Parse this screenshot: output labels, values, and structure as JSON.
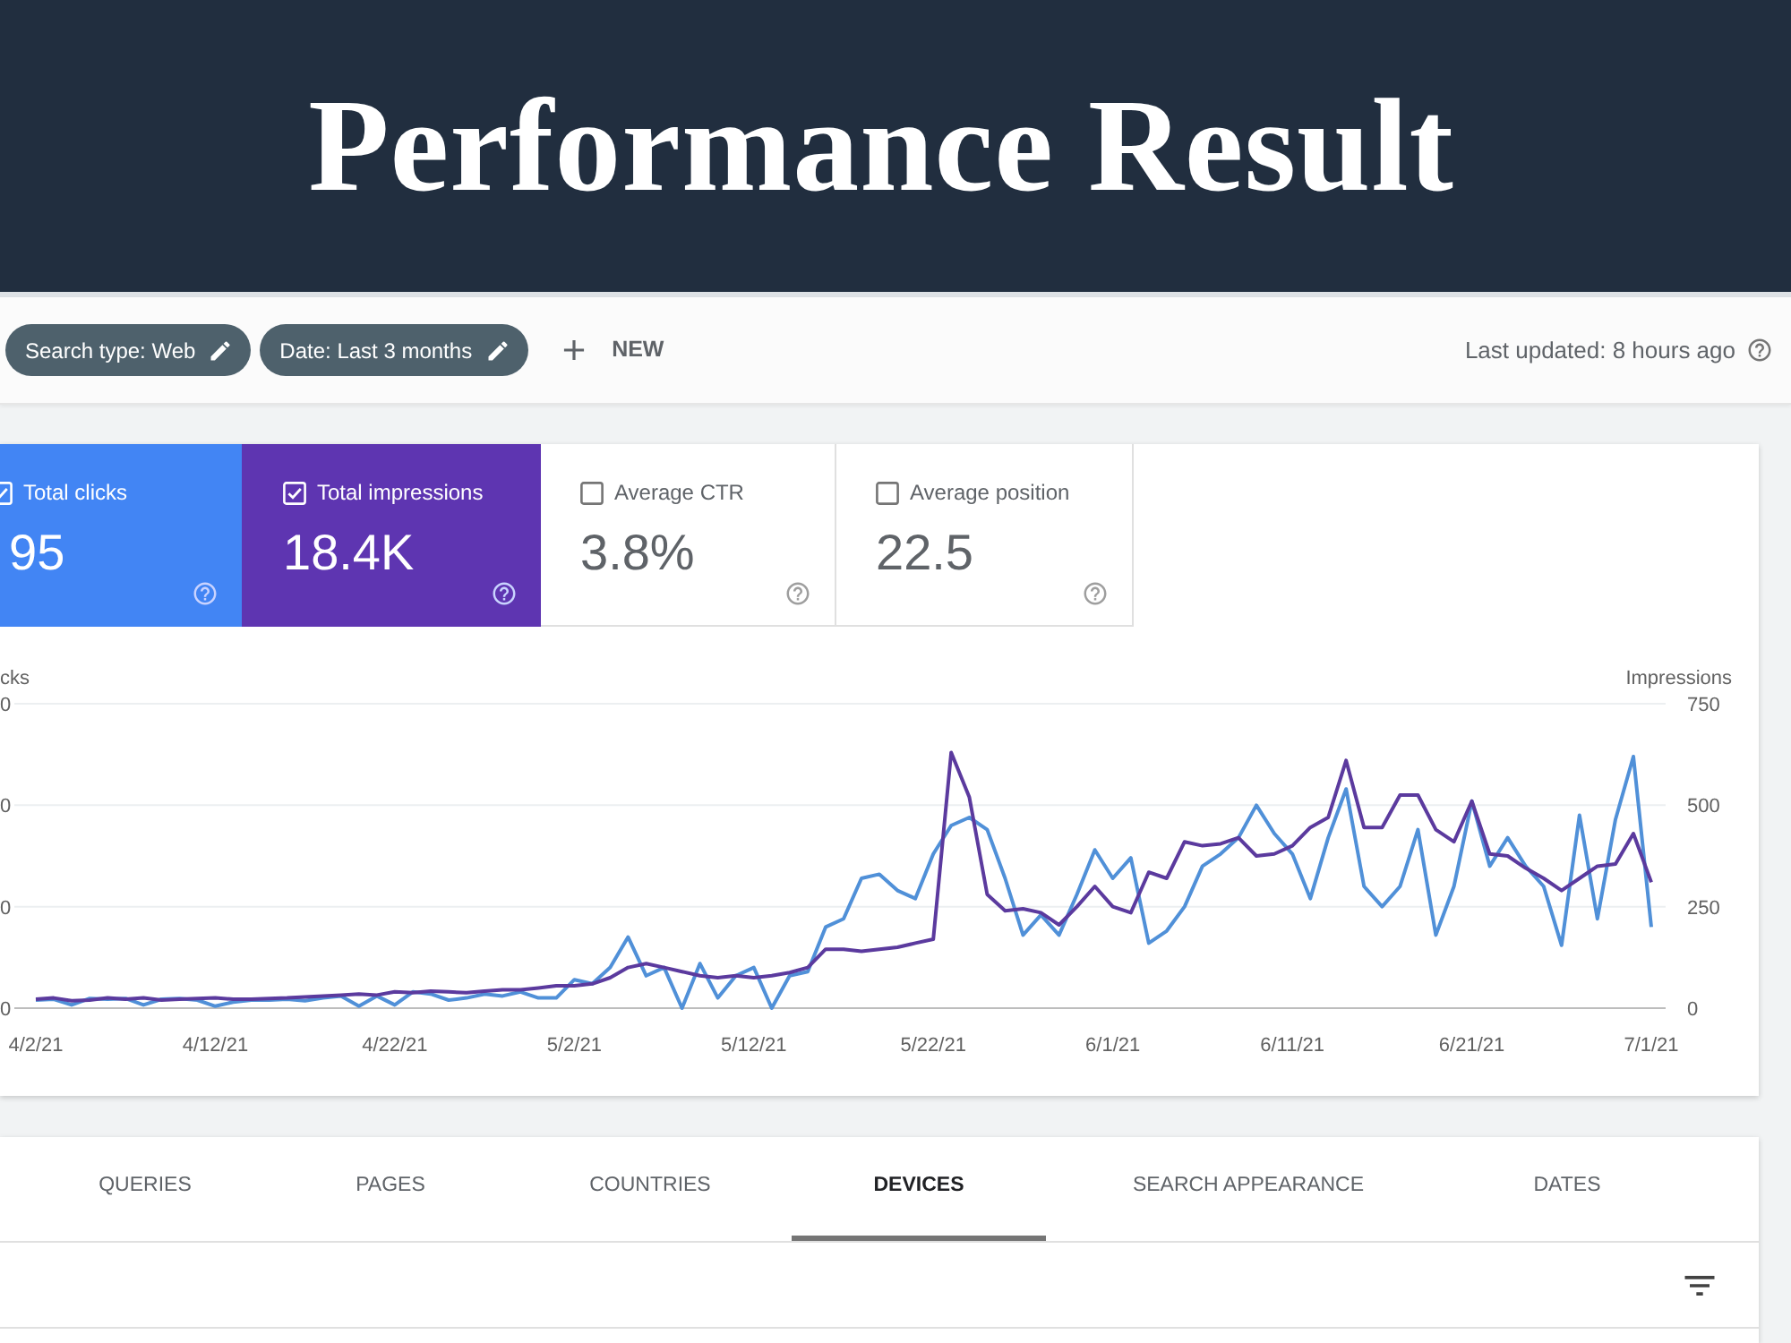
{
  "header": {
    "title": "Performance Result"
  },
  "filter_bar": {
    "chips": [
      {
        "label": "Search type: Web"
      },
      {
        "label": "Date: Last 3 months"
      }
    ],
    "new_button": {
      "label": "NEW"
    },
    "last_updated": "Last updated: 8 hours ago"
  },
  "metrics": [
    {
      "label": "Total clicks",
      "value": "95",
      "selected": true,
      "color": "#4285f4"
    },
    {
      "label": "Total impressions",
      "value": "18.4K",
      "selected": true,
      "color": "#5e35b1"
    },
    {
      "label": "Average CTR",
      "value": "3.8%",
      "selected": false
    },
    {
      "label": "Average position",
      "value": "22.5",
      "selected": false
    }
  ],
  "chart": {
    "left_axis": {
      "title": "cks",
      "ticks": [
        "0",
        "0",
        "0",
        "0"
      ]
    },
    "chart_data": {
      "type": "line",
      "ylabel": "Impressions",
      "ylim": [
        0,
        750
      ],
      "yticks": [
        0,
        250,
        500,
        750
      ],
      "categories": [
        "4/2/21",
        null,
        null,
        null,
        null,
        null,
        null,
        null,
        null,
        null,
        "4/12/21",
        null,
        null,
        null,
        null,
        null,
        null,
        null,
        null,
        null,
        "4/22/21",
        null,
        null,
        null,
        null,
        null,
        null,
        null,
        null,
        null,
        "5/2/21",
        null,
        null,
        null,
        null,
        null,
        null,
        null,
        null,
        null,
        "5/12/21",
        null,
        null,
        null,
        null,
        null,
        null,
        null,
        null,
        null,
        "5/22/21",
        null,
        null,
        null,
        null,
        null,
        null,
        null,
        null,
        null,
        "6/1/21",
        null,
        null,
        null,
        null,
        null,
        null,
        null,
        null,
        null,
        "6/11/21",
        null,
        null,
        null,
        null,
        null,
        null,
        null,
        null,
        null,
        "6/21/21",
        null,
        null,
        null,
        null,
        null,
        null,
        null,
        null,
        null,
        "7/1/21"
      ],
      "series": [
        {
          "color": "#5090d8",
          "values": [
            20,
            22,
            8,
            24,
            22,
            24,
            8,
            22,
            24,
            20,
            5,
            15,
            20,
            20,
            22,
            18,
            25,
            30,
            5,
            30,
            8,
            40,
            35,
            20,
            25,
            35,
            30,
            40,
            25,
            25,
            70,
            60,
            100,
            175,
            80,
            100,
            0,
            110,
            25,
            80,
            100,
            0,
            80,
            90,
            200,
            220,
            320,
            330,
            290,
            270,
            380,
            450,
            470,
            440,
            320,
            180,
            230,
            180,
            280,
            390,
            320,
            370,
            160,
            190,
            250,
            350,
            380,
            420,
            500,
            430,
            380,
            270,
            420,
            540,
            300,
            250,
            300,
            440,
            180,
            300,
            510,
            350,
            420,
            350,
            300,
            155,
            475,
            220,
            465,
            620,
            200
          ]
        },
        {
          "color": "#5b3a9e",
          "values": [
            22,
            25,
            18,
            20,
            25,
            22,
            25,
            20,
            22,
            24,
            25,
            22,
            22,
            24,
            25,
            28,
            30,
            32,
            35,
            32,
            40,
            38,
            42,
            40,
            38,
            42,
            45,
            45,
            50,
            55,
            55,
            60,
            75,
            100,
            110,
            100,
            90,
            80,
            75,
            80,
            75,
            80,
            88,
            100,
            145,
            145,
            140,
            145,
            150,
            160,
            170,
            630,
            520,
            280,
            240,
            245,
            235,
            205,
            250,
            300,
            250,
            235,
            335,
            320,
            410,
            400,
            405,
            420,
            375,
            380,
            400,
            445,
            470,
            610,
            445,
            445,
            525,
            525,
            440,
            410,
            510,
            380,
            375,
            345,
            320,
            290,
            320,
            350,
            355,
            430,
            310
          ]
        }
      ]
    }
  },
  "tabs": [
    {
      "label": "QUERIES",
      "selected": false
    },
    {
      "label": "PAGES",
      "selected": false
    },
    {
      "label": "COUNTRIES",
      "selected": false
    },
    {
      "label": "DEVICES",
      "selected": true
    },
    {
      "label": "SEARCH APPEARANCE",
      "selected": false
    },
    {
      "label": "DATES",
      "selected": false
    }
  ]
}
